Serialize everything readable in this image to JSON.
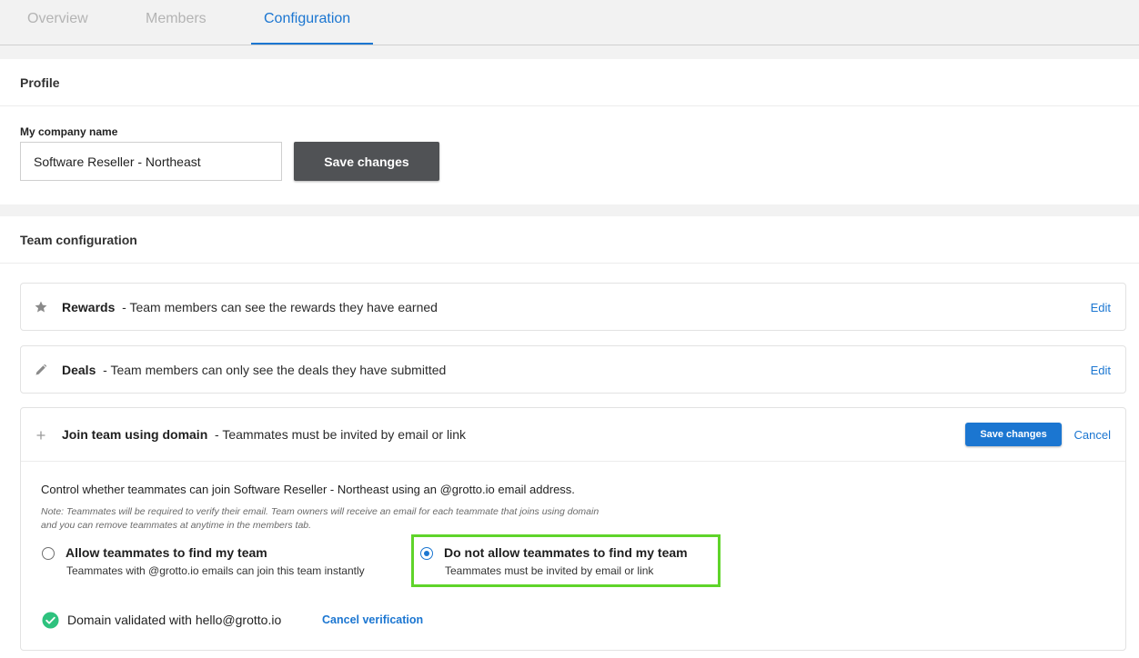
{
  "tabs": [
    {
      "label": "Overview"
    },
    {
      "label": "Members"
    },
    {
      "label": "Configuration"
    }
  ],
  "profile": {
    "header": "Profile",
    "company_label": "My company name",
    "company_value": "Software Reseller - Northeast",
    "save_label": "Save changes"
  },
  "team": {
    "header": "Team configuration",
    "rewards": {
      "title": "Rewards",
      "desc": "- Team members can see the rewards they have earned",
      "edit": "Edit",
      "icon": "star-icon"
    },
    "deals": {
      "title": "Deals",
      "desc": "- Team members can only see the deals they have submitted",
      "edit": "Edit",
      "icon": "pencil-icon"
    },
    "domain": {
      "title": "Join team using domain",
      "desc": "- Teammates must be invited by email or link",
      "icon": "plus-icon",
      "save_label": "Save changes",
      "cancel_label": "Cancel",
      "control_text": "Control whether teammates can join Software Reseller - Northeast using an @grotto.io email address.",
      "note_line1": "Note: Teammates will be required to verify their email. Team owners will receive an email for each teammate that joins using domain",
      "note_line2": "and you can remove teammates at anytime in the members tab.",
      "option_allow": {
        "title": "Allow teammates to find my team",
        "desc": "Teammates with @grotto.io emails can join this team instantly",
        "selected": false
      },
      "option_deny": {
        "title": "Do not allow teammates to find my team",
        "desc": "Teammates must be invited by email or link",
        "selected": true
      },
      "validated_text": "Domain validated with hello@grotto.io",
      "cancel_verification": "Cancel verification"
    }
  },
  "colors": {
    "accent": "#1b76d1",
    "success": "#2ec27e",
    "highlight": "#5fd42a",
    "dark_button": "#505255"
  }
}
